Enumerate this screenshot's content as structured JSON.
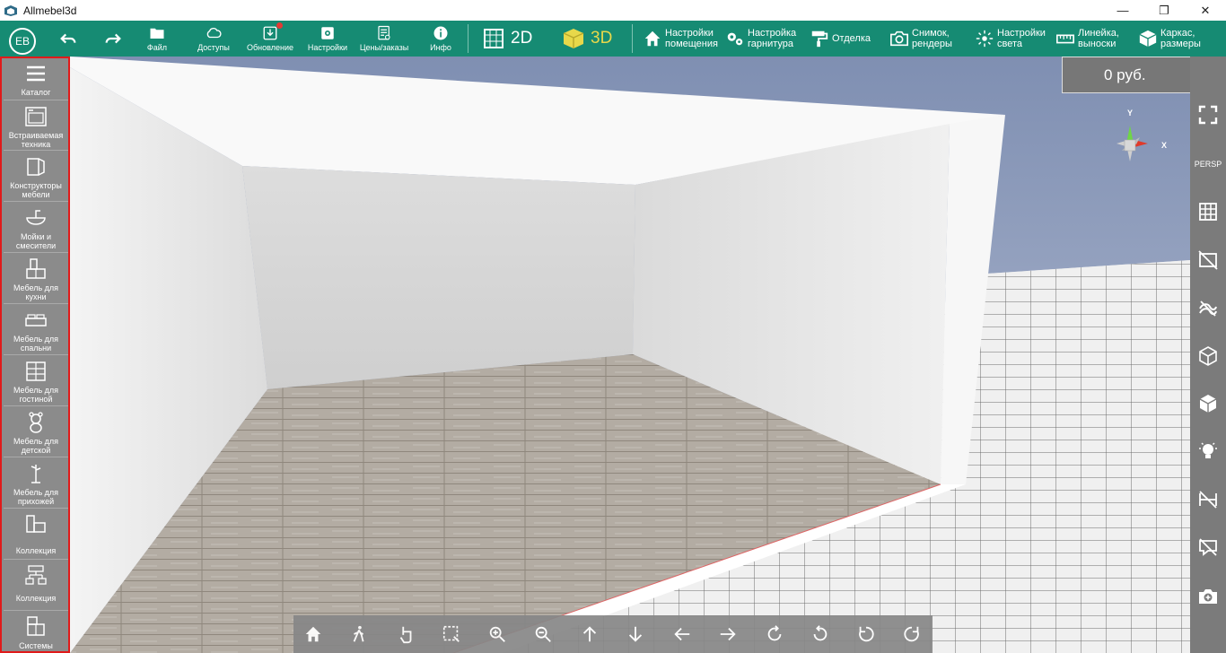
{
  "window": {
    "title": "Allmebel3d",
    "controls": [
      "minimize-icon",
      "restore-icon",
      "close-icon"
    ]
  },
  "toolbar": {
    "avatar_initials": "EB",
    "undo_icon": "undo-icon",
    "redo_icon": "redo-icon",
    "file_label": "Файл",
    "access_label": "Доступы",
    "update_label": "Обновление",
    "settings_label": "Настройки",
    "prices_label": "Цены/заказы",
    "info_label": "Инфо",
    "mode_2d": "2D",
    "mode_3d": "3D",
    "room_settings_label": "Настройки помещения",
    "furniture_settings_label": "Настройка гарнитура",
    "finishing_label": "Отделка",
    "snapshot_label": "Снимок, рендеры",
    "light_settings_label": "Настройки света",
    "ruler_label": "Линейка, выноски",
    "frame_label": "Каркас, размеры"
  },
  "sidebar": {
    "items": [
      {
        "label": "Каталог",
        "icon": "list-icon"
      },
      {
        "label": "Встраиваемая техника",
        "icon": "oven-icon"
      },
      {
        "label": "Конструкторы мебели",
        "icon": "furniture-constructor-icon"
      },
      {
        "label": "Мойки и смесители",
        "icon": "sink-icon"
      },
      {
        "label": "Мебель для кухни",
        "icon": "kitchen-icon"
      },
      {
        "label": "Мебель для спальни",
        "icon": "bed-icon"
      },
      {
        "label": "Мебель для гостиной",
        "icon": "shelf-icon"
      },
      {
        "label": "Мебель для детской",
        "icon": "teddy-bear-icon"
      },
      {
        "label": "Мебель для прихожей",
        "icon": "hanger-icon"
      },
      {
        "label": "Коллекция",
        "icon": "collection-icon"
      },
      {
        "label": "Коллекция",
        "icon": "collection-tree-icon"
      },
      {
        "label": "Системы",
        "icon": "systems-icon"
      }
    ]
  },
  "cart": {
    "price": "0 руб.",
    "icon": "cart-icon"
  },
  "gizmo": {
    "y_label": "Y",
    "x_label": "X"
  },
  "rightbar": {
    "items": [
      {
        "icon": "fullscreen-icon"
      },
      {
        "text": "PERSP"
      },
      {
        "icon": "grid-icon"
      },
      {
        "icon": "hide-walls-icon"
      },
      {
        "icon": "texture-icon"
      },
      {
        "icon": "wireframe-cube-icon"
      },
      {
        "icon": "solid-cube-icon"
      },
      {
        "icon": "light-bulb-icon"
      },
      {
        "icon": "hide-dimensions-icon"
      },
      {
        "icon": "hide-labels-icon"
      },
      {
        "icon": "add-camera-icon"
      }
    ]
  },
  "bottombar": {
    "items": [
      "home-icon",
      "walk-icon",
      "hand-pointer-icon",
      "select-area-icon",
      "zoom-in-icon",
      "zoom-out-icon",
      "arrow-up-icon",
      "arrow-down-icon",
      "arrow-left-icon",
      "arrow-right-icon",
      "orbit-right-icon",
      "orbit-left-icon",
      "rotate-left-icon",
      "rotate-right-icon"
    ]
  },
  "colors": {
    "toolbar_bg": "#168b73",
    "sidebar_bg": "#8b8b8b",
    "sidebar_border": "#e01a1a",
    "mode_3d_active": "#e8d84a"
  }
}
